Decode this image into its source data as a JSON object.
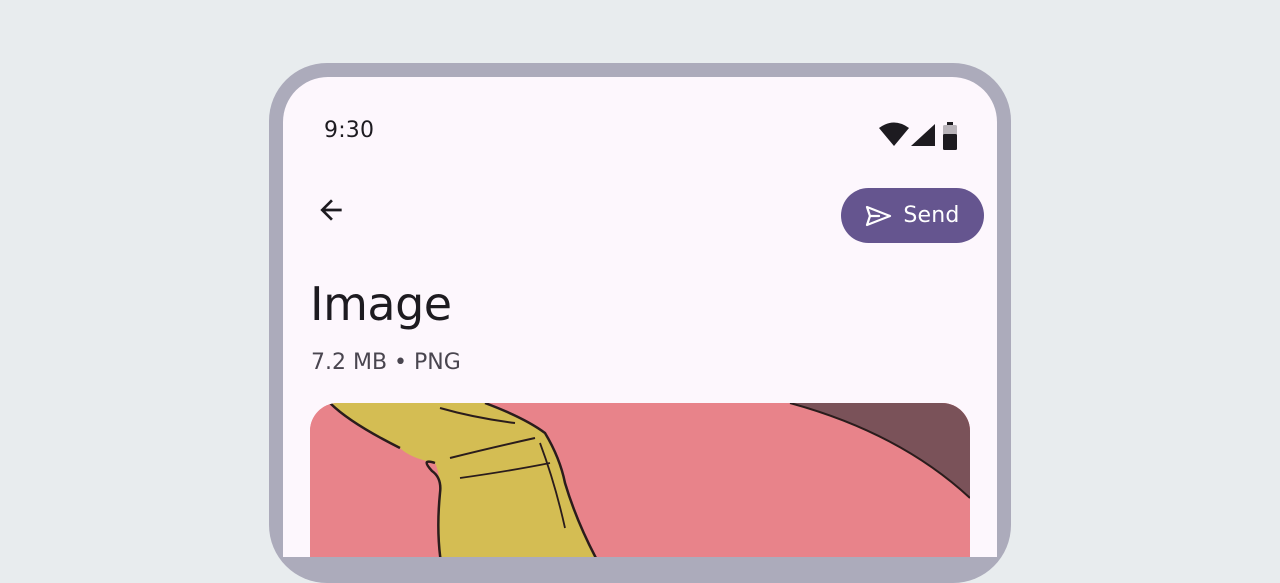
{
  "status_bar": {
    "time": "9:30",
    "icons": [
      "wifi-icon",
      "cellular-signal-icon",
      "battery-icon"
    ]
  },
  "top_bar": {
    "back_icon": "arrow-back-icon",
    "send_label": "Send",
    "send_icon": "send-icon"
  },
  "content": {
    "title": "Image",
    "subtitle": "7.2 MB • PNG"
  },
  "colors": {
    "background": "#e8ecee",
    "frame": "#acabbb",
    "surface": "#fdf7fd",
    "primary": "#65558f",
    "on_surface": "#1d1b20",
    "on_surface_variant": "#49454f"
  }
}
